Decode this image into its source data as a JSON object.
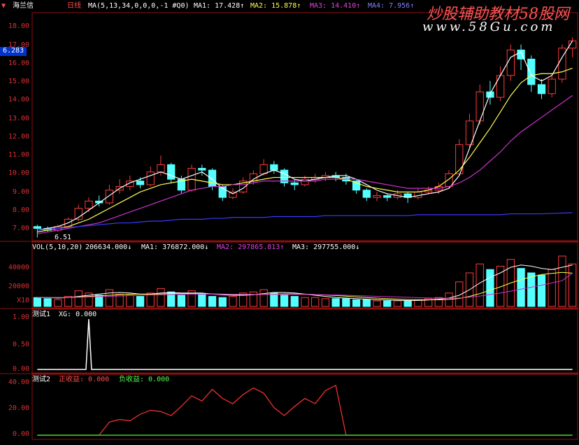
{
  "colors": {
    "up": "#ff3b3b",
    "down": "#54ffff",
    "ma1": "#ffffff",
    "ma2": "#ffff4d",
    "ma3": "#cc33cc",
    "ma4": "#3a3aff",
    "grid": "#8b1010",
    "axis": "#e03030",
    "indicator": "#ffffff",
    "profit": "#ff3333",
    "loss": "#33ff33"
  },
  "header": {
    "stock_name": "海兰信",
    "period": "日线",
    "formula": "MA(5,13,34,0,0,0,-1 #Q0)",
    "ma1": "MA1: 17.428↑",
    "ma2": "MA2: 15.878↑",
    "ma3": "MA3: 14.410↑",
    "ma4": "MA4: 7.956↑"
  },
  "watermark": {
    "title": "炒股辅助教材58股网",
    "url": "www.58Gu.com"
  },
  "price_panel": {
    "y_ticks": [
      "18.00",
      "17.00",
      "16.00",
      "15.00",
      "14.00",
      "13.00",
      "12.00",
      "11.00",
      "10.00",
      "9.00",
      "8.00",
      "7.00"
    ],
    "current_price": "6.283",
    "low_label": "6.51"
  },
  "volume_panel": {
    "header": {
      "name": "VOL(5,10,20)",
      "value": "206634.000↓",
      "ma1": "MA1: 376872.000↓",
      "ma2": "MA2: 297865.813↑",
      "ma3": "MA3: 297755.000↓"
    },
    "y_ticks": [
      "40000",
      "20000"
    ],
    "unit": "X10"
  },
  "indicator1": {
    "header": {
      "name": "测试1",
      "series": "XG: 0.000"
    },
    "y_ticks": [
      "1.00",
      "0.50",
      "0.00"
    ]
  },
  "indicator2": {
    "header": {
      "name": "测试2",
      "profit": "正收益: 0.000",
      "loss": "负收益: 0.000"
    },
    "y_ticks": [
      "40.00",
      "20.00",
      "0.00"
    ]
  },
  "chart_data": [
    {
      "type": "candlestick",
      "title": "海兰信 日线",
      "ylim": [
        6.5,
        18.8
      ],
      "series": [
        {
          "name": "MA1",
          "values": [
            7.0,
            7.1,
            7.2,
            7.4,
            7.7,
            8.1,
            8.5,
            8.9,
            9.3,
            9.6,
            9.8,
            10.0,
            10.2,
            10.0,
            9.8,
            10.0,
            10.2,
            9.8,
            9.3,
            9.0,
            9.3,
            9.8,
            10.1,
            10.3,
            10.1,
            9.8,
            9.7,
            9.8,
            9.9,
            10.0,
            10.0,
            9.8,
            9.5,
            9.2,
            9.0,
            8.9,
            8.8,
            8.9,
            9.0,
            9.1,
            9.3,
            10.0,
            11.5,
            13.0,
            14.5,
            15.5,
            16.5,
            16.8,
            15.5,
            15.2,
            15.5,
            16.5,
            17.4
          ]
        },
        {
          "name": "MA2",
          "values": [
            6.9,
            7.0,
            7.1,
            7.2,
            7.4,
            7.6,
            7.9,
            8.2,
            8.5,
            8.8,
            9.1,
            9.3,
            9.5,
            9.6,
            9.7,
            9.8,
            9.7,
            9.6,
            9.5,
            9.5,
            9.6,
            9.7,
            9.8,
            9.9,
            9.9,
            9.9,
            9.9,
            9.9,
            9.9,
            9.9,
            9.8,
            9.6,
            9.4,
            9.3,
            9.2,
            9.1,
            9.1,
            9.1,
            9.2,
            9.4,
            9.8,
            10.3,
            11.0,
            11.8,
            12.6,
            13.5,
            14.4,
            15.1,
            15.5,
            15.6,
            15.6,
            15.7,
            15.9
          ]
        },
        {
          "name": "MA3",
          "values": [
            6.8,
            6.9,
            7.0,
            7.1,
            7.2,
            7.3,
            7.4,
            7.6,
            7.8,
            8.0,
            8.2,
            8.4,
            8.6,
            8.8,
            9.0,
            9.2,
            9.3,
            9.4,
            9.4,
            9.5,
            9.5,
            9.6,
            9.7,
            9.7,
            9.7,
            9.7,
            9.7,
            9.7,
            9.8,
            9.8,
            9.8,
            9.8,
            9.7,
            9.6,
            9.5,
            9.4,
            9.3,
            9.3,
            9.3,
            9.3,
            9.4,
            9.6,
            9.9,
            10.3,
            10.8,
            11.3,
            11.9,
            12.4,
            12.8,
            13.2,
            13.6,
            14.0,
            14.4
          ]
        },
        {
          "name": "MA4",
          "values": [
            7.0,
            7.05,
            7.1,
            7.15,
            7.2,
            7.25,
            7.3,
            7.35,
            7.4,
            7.4,
            7.45,
            7.5,
            7.5,
            7.55,
            7.6,
            7.6,
            7.6,
            7.65,
            7.65,
            7.7,
            7.7,
            7.7,
            7.7,
            7.75,
            7.75,
            7.75,
            7.75,
            7.75,
            7.8,
            7.8,
            7.8,
            7.8,
            7.8,
            7.8,
            7.8,
            7.8,
            7.8,
            7.85,
            7.85,
            7.85,
            7.85,
            7.85,
            7.85,
            7.85,
            7.85,
            7.85,
            7.9,
            7.9,
            7.9,
            7.9,
            7.92,
            7.94,
            7.96
          ]
        }
      ],
      "candles": [
        [
          7.2,
          7.1,
          7.3,
          6.6
        ],
        [
          7.1,
          7.0,
          7.2,
          6.9
        ],
        [
          7.0,
          7.2,
          7.3,
          6.9
        ],
        [
          7.2,
          7.6,
          7.7,
          7.1
        ],
        [
          7.6,
          8.2,
          8.4,
          7.5
        ],
        [
          8.2,
          8.6,
          8.8,
          8.0
        ],
        [
          8.6,
          8.5,
          8.9,
          8.3
        ],
        [
          8.5,
          9.2,
          9.5,
          8.4
        ],
        [
          9.2,
          9.4,
          9.8,
          9.0
        ],
        [
          9.4,
          9.7,
          10.0,
          9.2
        ],
        [
          9.7,
          9.5,
          9.9,
          9.3
        ],
        [
          9.5,
          10.2,
          10.5,
          9.4
        ],
        [
          10.2,
          10.6,
          11.1,
          10.0
        ],
        [
          10.6,
          9.8,
          10.7,
          9.6
        ],
        [
          9.8,
          9.2,
          10.0,
          9.0
        ],
        [
          9.2,
          10.4,
          10.6,
          9.1
        ],
        [
          10.4,
          10.3,
          10.6,
          10.0
        ],
        [
          10.3,
          9.4,
          10.4,
          9.2
        ],
        [
          9.4,
          8.8,
          9.5,
          8.6
        ],
        [
          8.8,
          9.1,
          9.3,
          8.7
        ],
        [
          9.1,
          9.7,
          9.9,
          9.0
        ],
        [
          9.7,
          10.1,
          10.3,
          9.5
        ],
        [
          10.1,
          10.6,
          10.9,
          10.0
        ],
        [
          10.6,
          10.3,
          10.8,
          10.1
        ],
        [
          10.3,
          9.6,
          10.4,
          9.4
        ],
        [
          9.6,
          9.5,
          9.8,
          9.2
        ],
        [
          9.5,
          9.8,
          10.0,
          9.4
        ],
        [
          9.8,
          9.9,
          10.1,
          9.6
        ],
        [
          9.9,
          10.0,
          10.2,
          9.7
        ],
        [
          10.0,
          9.9,
          10.2,
          9.7
        ],
        [
          9.9,
          9.7,
          10.1,
          9.5
        ],
        [
          9.7,
          9.2,
          9.8,
          9.0
        ],
        [
          9.2,
          8.8,
          9.3,
          8.6
        ],
        [
          8.8,
          8.9,
          9.1,
          8.6
        ],
        [
          8.9,
          8.8,
          9.0,
          8.6
        ],
        [
          8.8,
          9.0,
          9.2,
          8.7
        ],
        [
          9.0,
          8.8,
          9.1,
          8.5
        ],
        [
          8.8,
          9.1,
          9.3,
          8.7
        ],
        [
          9.1,
          9.2,
          9.4,
          9.0
        ],
        [
          9.2,
          9.4,
          9.6,
          9.0
        ],
        [
          9.4,
          10.1,
          10.3,
          9.3
        ],
        [
          10.1,
          11.7,
          12.0,
          10.0
        ],
        [
          11.7,
          13.0,
          13.4,
          11.5
        ],
        [
          13.0,
          14.6,
          15.0,
          12.8
        ],
        [
          14.6,
          14.3,
          15.2,
          13.9
        ],
        [
          14.3,
          15.5,
          16.0,
          14.1
        ],
        [
          15.5,
          16.9,
          17.2,
          15.2
        ],
        [
          16.9,
          16.4,
          17.2,
          15.8
        ],
        [
          16.4,
          15.0,
          16.6,
          14.6
        ],
        [
          15.0,
          14.5,
          15.3,
          14.2
        ],
        [
          14.5,
          15.3,
          15.6,
          14.3
        ],
        [
          15.3,
          17.0,
          17.2,
          15.1
        ],
        [
          17.0,
          17.4,
          17.6,
          16.5
        ]
      ]
    },
    {
      "type": "bar",
      "title": "VOL(5,10,20)",
      "ylim": [
        0,
        50000
      ],
      "values": [
        8000,
        7000,
        6000,
        9000,
        14000,
        12000,
        10000,
        15000,
        11000,
        10000,
        9000,
        12000,
        16000,
        13000,
        10000,
        14000,
        11000,
        9000,
        8000,
        9000,
        12000,
        13000,
        15000,
        12000,
        10000,
        9000,
        8000,
        8000,
        7000,
        7000,
        7000,
        6000,
        6000,
        5000,
        5000,
        5000,
        5000,
        6000,
        7000,
        8000,
        12000,
        22000,
        30000,
        38000,
        33000,
        36000,
        42000,
        34000,
        30000,
        28000,
        33000,
        45000,
        38000
      ],
      "series": [
        {
          "name": "MA1",
          "values": [
            8000,
            8000,
            7500,
            8000,
            9000,
            10000,
            11000,
            12000,
            12500,
            12000,
            11000,
            11000,
            12000,
            12500,
            12000,
            12000,
            12000,
            11000,
            10500,
            10000,
            10000,
            10500,
            11500,
            12500,
            12500,
            12000,
            11000,
            10000,
            9000,
            8000,
            7500,
            7000,
            6500,
            6000,
            5800,
            5500,
            5300,
            5400,
            5800,
            6500,
            7500,
            10000,
            15000,
            21000,
            26000,
            30000,
            35000,
            37000,
            36000,
            34000,
            33000,
            35000,
            37000
          ]
        },
        {
          "name": "MA2",
          "values": [
            8000,
            8000,
            8000,
            8000,
            8500,
            9000,
            9500,
            10000,
            10500,
            11000,
            11000,
            11000,
            11200,
            11500,
            11500,
            11500,
            11500,
            11200,
            11000,
            10800,
            10600,
            10600,
            10800,
            11000,
            11200,
            11200,
            11000,
            10600,
            10200,
            9800,
            9200,
            8600,
            8000,
            7400,
            7000,
            6600,
            6200,
            6000,
            5900,
            6000,
            6300,
            7200,
            9000,
            11500,
            14500,
            17500,
            21000,
            24000,
            26500,
            28500,
            29500,
            30500,
            29800
          ]
        },
        {
          "name": "MA3",
          "values": [
            8000,
            8000,
            8000,
            8000,
            8200,
            8500,
            8800,
            9100,
            9400,
            9700,
            10000,
            10200,
            10400,
            10600,
            10800,
            11000,
            11000,
            11000,
            11000,
            10900,
            10800,
            10800,
            10800,
            10800,
            10800,
            10800,
            10800,
            10600,
            10400,
            10200,
            10000,
            9700,
            9400,
            9100,
            8800,
            8500,
            8200,
            7900,
            7600,
            7400,
            7300,
            7600,
            8300,
            9300,
            10600,
            12000,
            13700,
            15500,
            17200,
            19000,
            21000,
            23000,
            29800
          ]
        }
      ]
    },
    {
      "type": "line",
      "title": "测试1",
      "ylim": [
        0,
        1
      ],
      "series": [
        {
          "name": "XG",
          "values": [
            0,
            0,
            0,
            0,
            0,
            0,
            0,
            0,
            0,
            0,
            0,
            0,
            0,
            0,
            0,
            0,
            0,
            0,
            0,
            0,
            0,
            0,
            0,
            0,
            0,
            0,
            0,
            0,
            0,
            0,
            0,
            0,
            0,
            0,
            0,
            0,
            0,
            0,
            0,
            0,
            0,
            0,
            0,
            0,
            0,
            0,
            0,
            0,
            0,
            0,
            0,
            0,
            0
          ]
        }
      ],
      "spike": {
        "index": 5,
        "value": 1.0
      }
    },
    {
      "type": "line",
      "title": "测试2",
      "ylim": [
        0,
        40
      ],
      "series": [
        {
          "name": "正收益",
          "values": [
            0,
            0,
            0,
            0,
            0,
            0,
            0,
            10,
            12,
            11,
            16,
            19,
            18,
            15,
            22,
            30,
            26,
            35,
            28,
            24,
            31,
            36,
            32,
            21,
            15,
            22,
            28,
            24,
            34,
            38,
            0,
            0,
            0,
            0,
            0,
            0,
            0,
            0,
            0,
            0,
            0,
            0,
            0,
            0,
            0,
            0,
            0,
            0,
            0,
            0,
            0,
            0,
            0
          ]
        },
        {
          "name": "负收益",
          "values": [
            0,
            0,
            0,
            0,
            0,
            0,
            0,
            0,
            0,
            0,
            0,
            0,
            0,
            0,
            0,
            0,
            0,
            0,
            0,
            0,
            0,
            0,
            0,
            0,
            0,
            0,
            0,
            0,
            0,
            0,
            0,
            0,
            0,
            0,
            0,
            0,
            0,
            0,
            0,
            0,
            0,
            0,
            0,
            0,
            0,
            0,
            0,
            0,
            0,
            0,
            0,
            0,
            0
          ]
        }
      ]
    }
  ]
}
